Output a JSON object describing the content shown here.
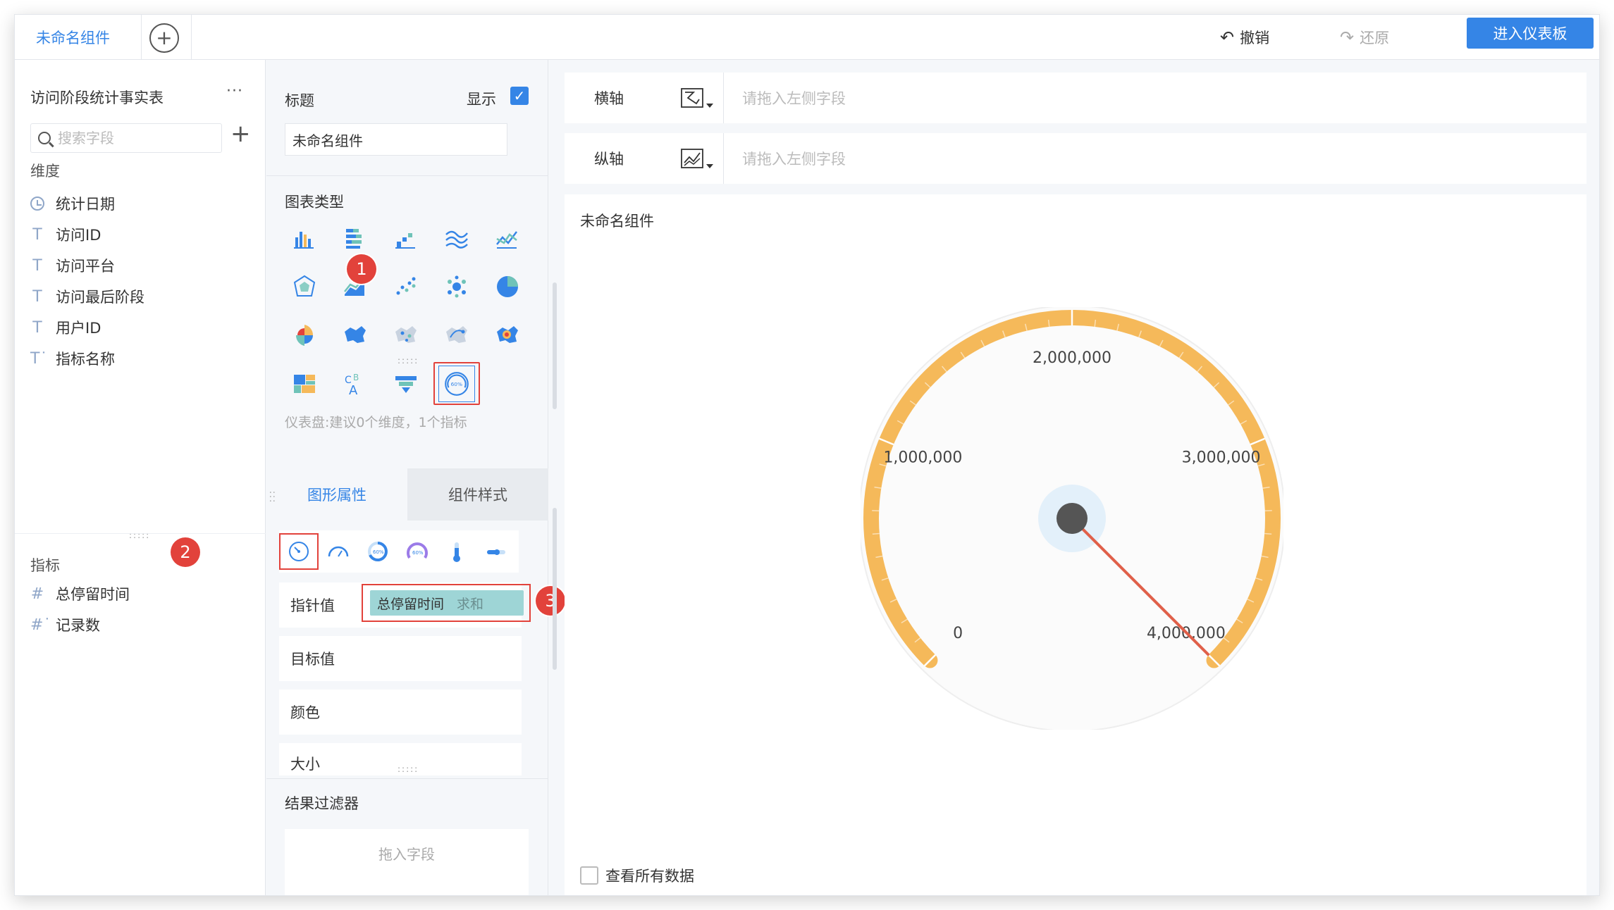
{
  "topbar": {
    "active_tab": "未命名组件",
    "add_tab": "+",
    "undo_label": "撤销",
    "redo_label": "还原",
    "enter_dashboard": "进入仪表板"
  },
  "left_panel": {
    "dataset_title": "访问阶段统计事实表",
    "more": "···",
    "search_placeholder": "搜索字段",
    "dimensions_label": "维度",
    "dimensions": [
      {
        "icon": "clock-icon",
        "label": "统计日期"
      },
      {
        "icon": "text-icon",
        "glyph": "T",
        "label": "访问ID"
      },
      {
        "icon": "text-icon",
        "glyph": "T",
        "label": "访问平台"
      },
      {
        "icon": "text-icon",
        "glyph": "T",
        "label": "访问最后阶段"
      },
      {
        "icon": "text-icon",
        "glyph": "T",
        "label": "用户ID"
      },
      {
        "icon": "calc-text-icon",
        "glyph": "T˙",
        "label": "指标名称"
      }
    ],
    "metrics_label": "指标",
    "metrics": [
      {
        "icon": "hash-icon",
        "glyph": "#",
        "label": "总停留时间"
      },
      {
        "icon": "calc-hash-icon",
        "glyph": "#˙",
        "label": "记录数"
      }
    ]
  },
  "mid_panel": {
    "title_label": "标题",
    "show_label": "显示",
    "show_checked": "✓",
    "title_value": "未命名组件",
    "chart_types_label": "图表类型",
    "chart_type_hint": "仪表盘:建议0个维度，1个指标",
    "tabs": {
      "shape_props": "图形属性",
      "component_style": "组件样式"
    },
    "props": {
      "pointer_label": "指针值",
      "pointer_field": "总停留时间",
      "pointer_agg": "求和",
      "target_label": "目标值",
      "color_label": "颜色",
      "size_label": "大小"
    },
    "result_filter_label": "结果过滤器",
    "drop_field": "拖入字段"
  },
  "badges": {
    "b1": "1",
    "b2": "2",
    "b3": "3"
  },
  "axes": {
    "x_label": "横轴",
    "y_label": "纵轴",
    "placeholder": "请拖入左侧字段"
  },
  "canvas": {
    "title": "未命名组件",
    "view_all": "查看所有数据"
  },
  "chart_data": {
    "type": "gauge",
    "title": "未命名组件",
    "min": 0,
    "max": 4000000,
    "tick_labels": [
      "0",
      "1,000,000",
      "2,000,000",
      "3,000,000",
      "4,000,000"
    ],
    "ticks": [
      0,
      1000000,
      2000000,
      3000000,
      4000000
    ],
    "value": 4000000,
    "arc_color": "#f5b95a",
    "pointer_color": "#e0604a",
    "hub_color": "#555555"
  },
  "colors": {
    "accent": "#3585e6",
    "highlight_red": "#e2423b",
    "chip_bg": "#9ed5d6"
  }
}
